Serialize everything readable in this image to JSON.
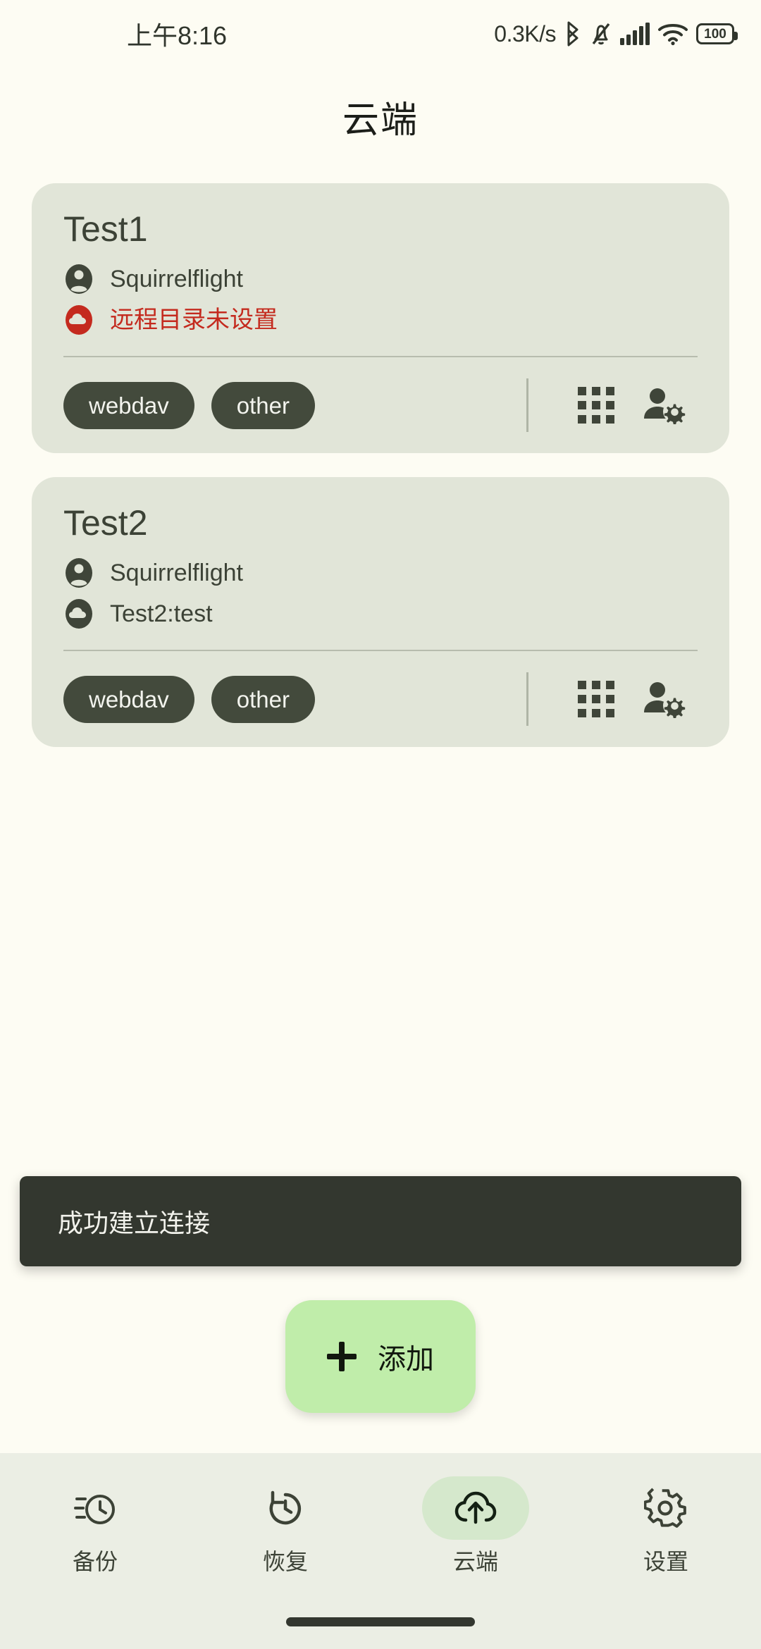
{
  "status_bar": {
    "time": "上午8:16",
    "network_speed": "0.3K/s",
    "battery_level": "100",
    "icons": [
      "bluetooth-icon",
      "silent-mode-icon",
      "cellular-signal-icon",
      "wifi-icon",
      "battery-icon"
    ]
  },
  "header": {
    "title": "云端"
  },
  "cards": [
    {
      "name": "Test1",
      "account": "Squirrelflight",
      "path": "远程目录未设置",
      "path_status": "warning",
      "path_color": "#C42A1E",
      "chips": [
        "webdav",
        "other"
      ],
      "actions": [
        "grid-apps-icon",
        "user-settings-icon"
      ]
    },
    {
      "name": "Test2",
      "account": "Squirrelflight",
      "path": "Test2:test",
      "path_status": "ok",
      "path_color": "#3C4236",
      "chips": [
        "webdav",
        "other"
      ],
      "actions": [
        "grid-apps-icon",
        "user-settings-icon"
      ]
    }
  ],
  "snackbar": {
    "message": "成功建立连接"
  },
  "fab": {
    "label": "添加",
    "icon": "plus-icon",
    "color": "#C0EDAA"
  },
  "bottom_nav": {
    "items": [
      {
        "label": "备份",
        "icon": "backup-clock-icon",
        "active": false
      },
      {
        "label": "恢复",
        "icon": "restore-history-icon",
        "active": false
      },
      {
        "label": "云端",
        "icon": "cloud-upload-icon",
        "active": true
      },
      {
        "label": "设置",
        "icon": "gear-icon",
        "active": false
      }
    ]
  },
  "theme": {
    "page_background": "#FDFCF3",
    "card_background": "#E1E5D8",
    "nav_background": "#EBEEE4",
    "accent": "#C0EDAA",
    "chip_background": "#434A3C",
    "snackbar_background": "#33372F",
    "warning": "#C42A1E"
  }
}
